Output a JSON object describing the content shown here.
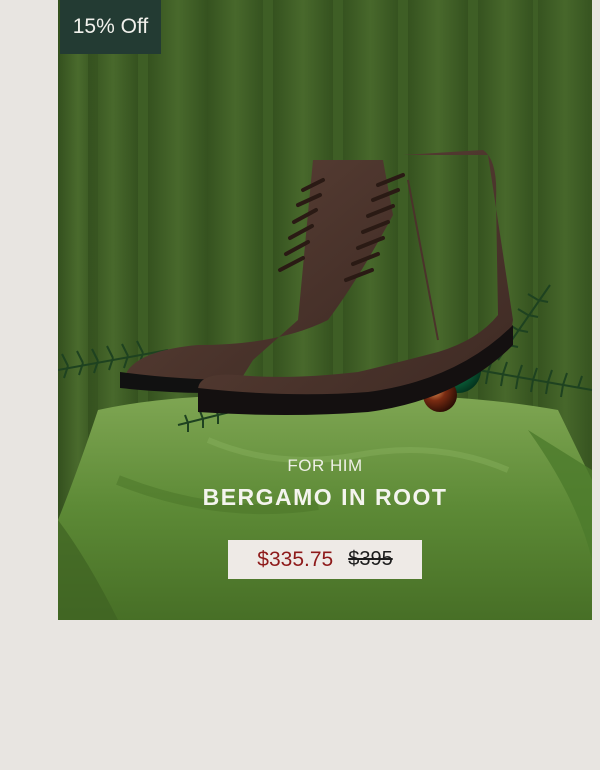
{
  "badge": {
    "label": "15% Off"
  },
  "product": {
    "category": "FOR HIM",
    "name": "BERGAMO IN ROOT",
    "sale_price": "$335.75",
    "original_price": "$395"
  },
  "colors": {
    "page_background": "#e8e5e1",
    "badge_background": "#233b33",
    "sale_price": "#8e1a1a",
    "price_box": "#eeeae6"
  },
  "icons": [
    "product-photo-boots"
  ]
}
